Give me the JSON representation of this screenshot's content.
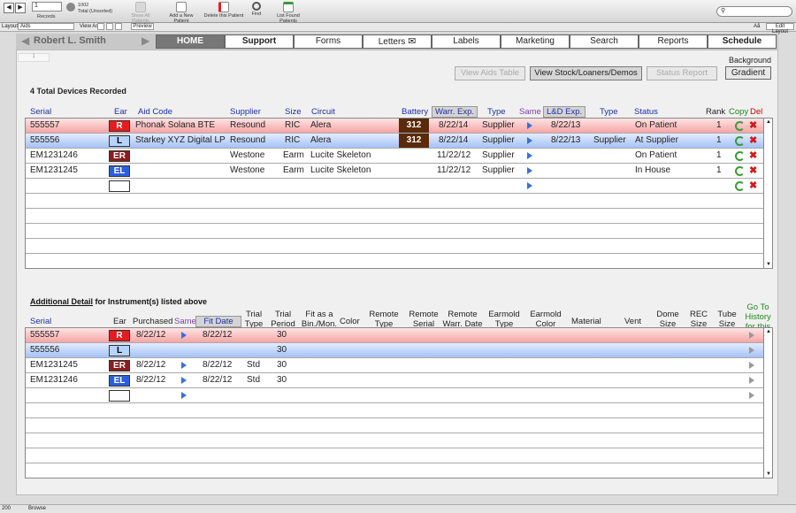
{
  "toolbar": {
    "records_value": "1",
    "records_label": "Records",
    "total": "1002",
    "total_label": "Total (Unsorted)",
    "buttons": [
      {
        "label": "Show All Patients",
        "icon": "show-all-icon"
      },
      {
        "label": "Add a New Patient",
        "icon": "add-patient-icon"
      },
      {
        "label": "Delete this Patient",
        "icon": "delete-patient-icon"
      },
      {
        "label": "Find",
        "icon": "find-icon"
      },
      {
        "label": "List Found Patients",
        "icon": "list-found-icon"
      }
    ],
    "search_placeholder": ""
  },
  "layoutbar": {
    "layout_label": "Layout:",
    "layout_value": "Aids",
    "view_as_label": "View As:",
    "preview_label": "Preview",
    "aa_label": "Aå",
    "edit_layout_label": "Edit Layout"
  },
  "nav": {
    "patient_name": "Robert L. Smith",
    "prev_arrow": "◀",
    "next_arrow": "▶",
    "tabs": [
      "HOME",
      "Support",
      "Forms",
      "Letters",
      "Labels",
      "Marketing",
      "Search",
      "Reports",
      "Schedule"
    ],
    "letters_icon": "envelope-icon"
  },
  "record_tab": "1",
  "actions": {
    "view_aids_table": "View Aids Table",
    "view_stock": "View Stock/Loaners/Demos",
    "status_report": "Status Report",
    "background_label": "Background",
    "gradient": "Gradient"
  },
  "devices": {
    "count_label": "4 Total Devices Recorded",
    "headers": {
      "serial": "Serial",
      "ear": "Ear",
      "aid_code": "Aid Code",
      "supplier": "Supplier",
      "size": "Size",
      "circuit": "Circuit",
      "battery": "Battery",
      "warr_exp": "Warr. Exp.",
      "type": "Type",
      "same": "Same",
      "ld_exp": "L&D  Exp.",
      "type2": "Type",
      "status": "Status",
      "rank": "Rank",
      "copy": "Copy",
      "del": "Del"
    },
    "rows": [
      {
        "serial": "555557",
        "ear": "R",
        "aid_code": "Phonak Solana BTE",
        "supplier": "Resound",
        "size": "RIC",
        "circuit": "Alera",
        "battery": "312",
        "warr_exp": "8/22/14",
        "type": "Supplier",
        "ld_exp": "8/22/13",
        "type2": "",
        "status": "On Patient",
        "rank": "1"
      },
      {
        "serial": "555556",
        "ear": "L",
        "aid_code": "Starkey XYZ Digital LP",
        "supplier": "Resound",
        "size": "RIC",
        "circuit": "Alera",
        "battery": "312",
        "warr_exp": "8/22/14",
        "type": "Supplier",
        "ld_exp": "8/22/13",
        "type2": "Supplier",
        "status": "At Supplier",
        "rank": "1"
      },
      {
        "serial": "EM1231246",
        "ear": "ER",
        "aid_code": "",
        "supplier": "Westone",
        "size": "Earm",
        "circuit": "Lucite Skeleton",
        "battery": "",
        "warr_exp": "11/22/12",
        "type": "Supplier",
        "ld_exp": "",
        "type2": "",
        "status": "On Patient",
        "rank": "1"
      },
      {
        "serial": "EM1231245",
        "ear": "EL",
        "aid_code": "",
        "supplier": "Westone",
        "size": "Earm",
        "circuit": "Lucite Skeleton",
        "battery": "",
        "warr_exp": "11/22/12",
        "type": "Supplier",
        "ld_exp": "",
        "type2": "",
        "status": "In House",
        "rank": "1"
      }
    ]
  },
  "detail": {
    "title_underlined": "Additional Detail",
    "title_rest": " for Instrument(s) listed above",
    "headers": {
      "serial": "Serial",
      "ear": "Ear",
      "purchased": "Purchased",
      "same": "Same",
      "fit_date": "Fit Date",
      "trial_type": "Trial Type",
      "trial_period": "Trial Period",
      "fit_as": "Fit as a Bin./Mon.",
      "color": "Color",
      "remote_type": "Remote Type",
      "remote_serial": "Remote Serial",
      "remote_warr": "Remote Warr. Date",
      "earmold_type": "Earmold Type",
      "earmold_color": "Earmold Color",
      "material": "Material",
      "vent": "Vent",
      "dome_size": "Dome Size",
      "rec_size": "REC Size",
      "tube_size": "Tube Size",
      "go_to": "Go To History for this Aid"
    },
    "rows": [
      {
        "serial": "555557",
        "ear": "R",
        "purchased": "8/22/12",
        "fit_date": "8/22/12",
        "trial_type": "",
        "trial_period": "30"
      },
      {
        "serial": "555556",
        "ear": "L",
        "purchased": "",
        "fit_date": "",
        "trial_type": "",
        "trial_period": "30"
      },
      {
        "serial": "EM1231245",
        "ear": "ER",
        "purchased": "8/22/12",
        "fit_date": "8/22/12",
        "trial_type": "Std",
        "trial_period": "30"
      },
      {
        "serial": "EM1231246",
        "ear": "EL",
        "purchased": "8/22/12",
        "fit_date": "8/22/12",
        "trial_type": "Std",
        "trial_period": "30"
      }
    ]
  },
  "statusbar": {
    "zoom": "200",
    "mode": "Browse"
  },
  "colors": {
    "header_text": "#1d2ea6",
    "row_red": "#f6a5a5",
    "row_blue": "#a5c2f6",
    "battery": "#5a2a0a"
  }
}
